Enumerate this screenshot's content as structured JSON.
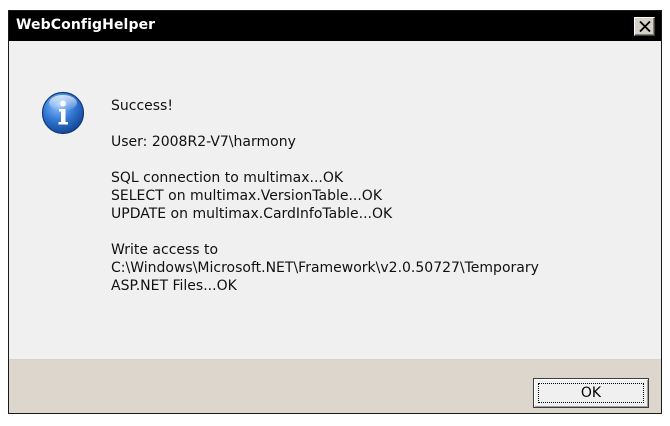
{
  "window": {
    "title": "WebConfigHelper"
  },
  "icons": {
    "dialog_icon": "info-icon",
    "close": "close-icon"
  },
  "message": {
    "heading": "Success!",
    "user": "User: 2008R2-V7\\harmony",
    "checks": [
      "SQL connection to multimax...OK",
      "SELECT on multimax.VersionTable...OK",
      "UPDATE on multimax.CardInfoTable...OK"
    ],
    "write_access": [
      "Write access to",
      "C:\\Windows\\Microsoft.NET\\Framework\\v2.0.50727\\Temporary",
      "ASP.NET Files...OK"
    ]
  },
  "buttons": {
    "ok": "OK"
  },
  "colors": {
    "titlebar": "#000000",
    "dialog_body": "#f0f0f0",
    "footer": "#dcd6cd",
    "icon_blue": "#1f5fb8"
  }
}
